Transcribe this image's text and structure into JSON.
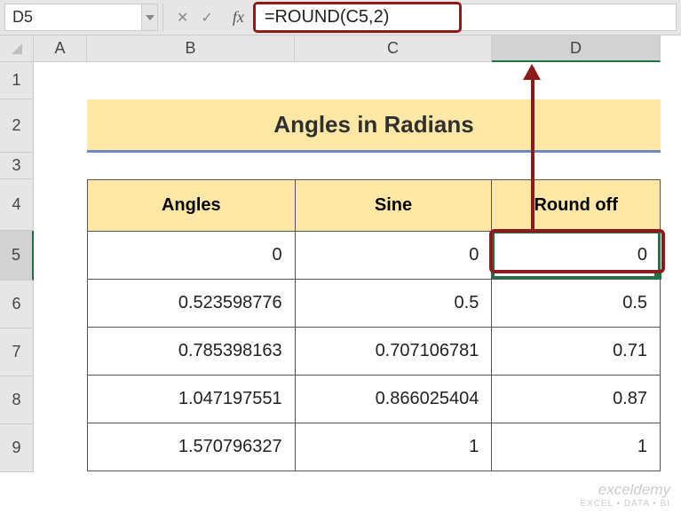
{
  "name_box": "D5",
  "formula": "=ROUND(C5,2)",
  "fx_label": "fx",
  "col_headers": [
    "A",
    "B",
    "C",
    "D"
  ],
  "row_headers": [
    "1",
    "2",
    "3",
    "4",
    "5",
    "6",
    "7",
    "8",
    "9"
  ],
  "title": "Angles in Radians",
  "table": {
    "headers": [
      "Angles",
      "Sine",
      "Round off"
    ],
    "rows": [
      {
        "angles": "0",
        "sine": "0",
        "round": "0"
      },
      {
        "angles": "0.523598776",
        "sine": "0.5",
        "round": "0.5"
      },
      {
        "angles": "0.785398163",
        "sine": "0.707106781",
        "round": "0.71"
      },
      {
        "angles": "1.047197551",
        "sine": "0.866025404",
        "round": "0.87"
      },
      {
        "angles": "1.570796327",
        "sine": "1",
        "round": "1"
      }
    ]
  },
  "watermark": {
    "brand": "exceldemy",
    "tag": "EXCEL • DATA • BI"
  },
  "chart_data": {
    "type": "table",
    "title": "Angles in Radians",
    "columns": [
      "Angles",
      "Sine",
      "Round off"
    ],
    "data": [
      [
        0,
        0,
        0
      ],
      [
        0.523598776,
        0.5,
        0.5
      ],
      [
        0.785398163,
        0.707106781,
        0.71
      ],
      [
        1.047197551,
        0.866025404,
        0.87
      ],
      [
        1.570796327,
        1,
        1
      ]
    ],
    "formula_d5": "=ROUND(C5,2)"
  }
}
